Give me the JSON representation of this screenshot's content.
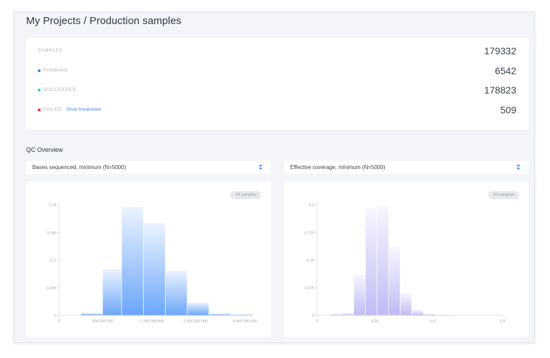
{
  "page": {
    "title": "My Projects / Production samples"
  },
  "stats": [
    {
      "key": "samples",
      "label": "SAMPLES",
      "value": "179332",
      "color": ""
    },
    {
      "key": "running",
      "label": "RUNNING",
      "value": "6542",
      "color": "#3b82f6"
    },
    {
      "key": "succeeded",
      "label": "SUCCEEDED",
      "value": "178823",
      "color": "#2dd4a4"
    },
    {
      "key": "failed",
      "label": "FAILED",
      "value": "509",
      "color": "#e53e3e",
      "link": "Show breakdown"
    }
  ],
  "qc": {
    "heading": "QC Overview",
    "left_select": {
      "label": "Bases sequenced, minimum (N=5000)",
      "icon": "updown-arrows-icon"
    },
    "right_select": {
      "label": "Effective coverage, minimum (N=5000)",
      "icon": "updown-arrows-icon"
    },
    "badge_label": "All samples"
  },
  "colors": {
    "left_bar": "#5b9cf8",
    "right_bar": "#b9b4f5",
    "select_arrows": "#3b82f6"
  },
  "chart_data": [
    {
      "type": "bar",
      "title": "",
      "xlabel": "",
      "ylabel": "",
      "x_range": [
        0,
        3400000000
      ],
      "ylim": [
        0,
        0.24
      ],
      "x_ticks": [
        0,
        800000000,
        1700000000,
        2500000000,
        3400000000
      ],
      "x_tick_labels": [
        "0",
        "800,000,000",
        "1,700,000,000",
        "2,500,000,000",
        "3,400,000,000"
      ],
      "y_ticks": [
        0,
        0.06,
        0.12,
        0.18,
        0.24
      ],
      "y_tick_labels": [
        "0",
        "0.055",
        "0.11",
        "0.165",
        "0.24"
      ],
      "grid": false,
      "bins": [
        {
          "x0": 400000000,
          "x1": 800000000,
          "y": 0.005
        },
        {
          "x0": 800000000,
          "x1": 1150000000,
          "y": 0.1
        },
        {
          "x0": 1150000000,
          "x1": 1550000000,
          "y": 0.235
        },
        {
          "x0": 1550000000,
          "x1": 1950000000,
          "y": 0.2
        },
        {
          "x0": 1950000000,
          "x1": 2350000000,
          "y": 0.097
        },
        {
          "x0": 2350000000,
          "x1": 2750000000,
          "y": 0.028
        },
        {
          "x0": 2750000000,
          "x1": 3150000000,
          "y": 0.004
        },
        {
          "x0": 3150000000,
          "x1": 3550000000,
          "y": 0.002
        }
      ]
    },
    {
      "type": "bar",
      "title": "",
      "xlabel": "",
      "ylabel": "",
      "x_range": [
        0,
        0.8
      ],
      "ylim": [
        0,
        0.3
      ],
      "x_ticks": [
        0,
        0.25,
        0.5,
        0.8
      ],
      "x_tick_labels": [
        "0",
        "0.25",
        "0.5",
        "0.8"
      ],
      "y_ticks": [
        0,
        0.075,
        0.15,
        0.225,
        0.3
      ],
      "y_tick_labels": [
        "0",
        "0.075",
        "0.15",
        "0.225",
        "0.3"
      ],
      "grid": false,
      "bins": [
        {
          "x0": 0.06,
          "x1": 0.11,
          "y": 0.004
        },
        {
          "x0": 0.11,
          "x1": 0.16,
          "y": 0.006
        },
        {
          "x0": 0.16,
          "x1": 0.21,
          "y": 0.11
        },
        {
          "x0": 0.21,
          "x1": 0.26,
          "y": 0.29
        },
        {
          "x0": 0.26,
          "x1": 0.31,
          "y": 0.295
        },
        {
          "x0": 0.31,
          "x1": 0.36,
          "y": 0.185
        },
        {
          "x0": 0.36,
          "x1": 0.41,
          "y": 0.06
        },
        {
          "x0": 0.41,
          "x1": 0.46,
          "y": 0.015
        },
        {
          "x0": 0.46,
          "x1": 0.51,
          "y": 0.004
        },
        {
          "x0": 0.51,
          "x1": 0.58,
          "y": 0.002
        }
      ]
    }
  ]
}
